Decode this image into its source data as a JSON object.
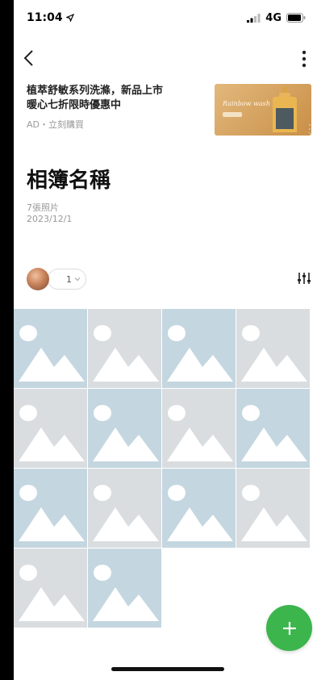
{
  "status_bar": {
    "time": "11:04",
    "network": "4G",
    "icons": [
      "location-arrow-icon",
      "signal-icon",
      "battery-icon"
    ]
  },
  "nav": {
    "back_icon": "chevron-left-icon",
    "more_icon": "vertical-ellipsis-icon"
  },
  "ad": {
    "headline_line1": "植萃舒敏系列洗滌，新品上市",
    "headline_line2": "暖心七折限時優惠中",
    "meta": "AD・立刻購買",
    "image_caption": "Rainbow wash",
    "more_icon": "vertical-ellipsis-icon"
  },
  "album": {
    "title": "相簿名稱",
    "photo_count": "7張照片",
    "date": "2023/12/1"
  },
  "members": {
    "count": "1",
    "filter_icon": "sliders-icon"
  },
  "photos": {
    "tile_pattern": [
      "blue",
      "gray",
      "blue",
      "gray",
      "gray",
      "blue",
      "gray",
      "blue",
      "blue",
      "gray",
      "blue",
      "gray",
      "gray",
      "blue"
    ],
    "icon": "image-placeholder-icon"
  },
  "colors": {
    "tile_blue": "#c4d6e0",
    "tile_gray": "#d9dde0",
    "accent_green": "#3cb54d"
  },
  "fab": {
    "icon": "plus-icon"
  }
}
